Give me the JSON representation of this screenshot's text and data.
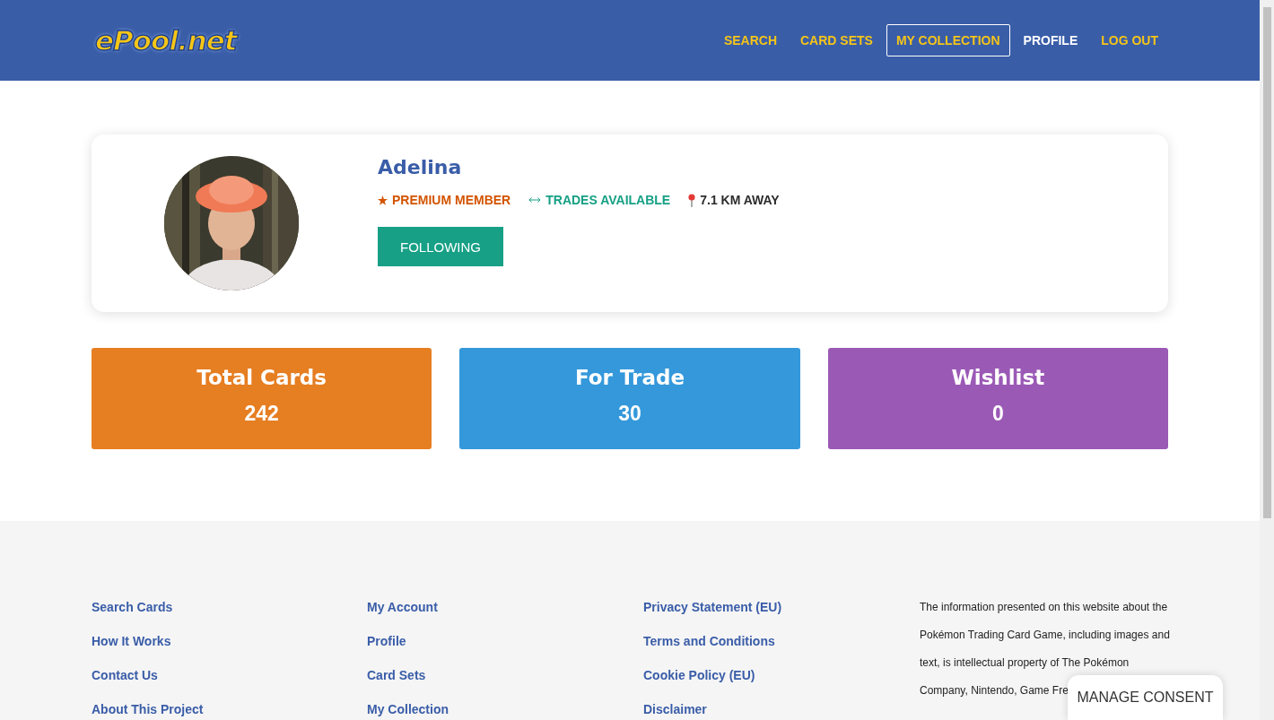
{
  "header": {
    "logo": "ePool.net",
    "nav": [
      {
        "label": "SEARCH",
        "selected": false,
        "color": "#f5c518"
      },
      {
        "label": "CARD SETS",
        "selected": false,
        "color": "#f5c518"
      },
      {
        "label": "MY COLLECTION",
        "selected": true,
        "color": "#f5c518"
      },
      {
        "label": "PROFILE",
        "selected": false,
        "color": "#ffffff"
      },
      {
        "label": "LOG OUT",
        "selected": false,
        "color": "#f5c518"
      }
    ]
  },
  "profile": {
    "name": "Adelina",
    "badges": [
      {
        "kind": "star",
        "label": "PREMIUM MEMBER",
        "color": "#d35400"
      },
      {
        "kind": "arrows",
        "label": "TRADES AVAILABLE",
        "color": "#16a085"
      },
      {
        "kind": "pin",
        "label": "7.1 KM AWAY",
        "color": "#2c2c2c"
      }
    ],
    "follow_button": "FOLLOWING"
  },
  "stats": [
    {
      "title": "Total Cards",
      "value": "242",
      "color": "#e67e22"
    },
    {
      "title": "For Trade",
      "value": "30",
      "color": "#3498db"
    },
    {
      "title": "Wishlist",
      "value": "0",
      "color": "#9b59b6"
    }
  ],
  "footer": {
    "columns": [
      [
        "Search Cards",
        "How It Works",
        "Contact Us",
        "About This Project"
      ],
      [
        "My Account",
        "Profile",
        "Card Sets",
        "My Collection"
      ],
      [
        "Privacy Statement (EU)",
        "Terms and Conditions",
        "Cookie Policy (EU)",
        "Disclaimer"
      ]
    ],
    "notice_lines": [
      "The information presented on this website about the",
      "Pokémon Trading Card Game, including images and",
      "text, is intellectual property of The Pokémon",
      "Company, Nintendo, Game Fre"
    ]
  },
  "consent_button": "MANAGE CONSENT"
}
